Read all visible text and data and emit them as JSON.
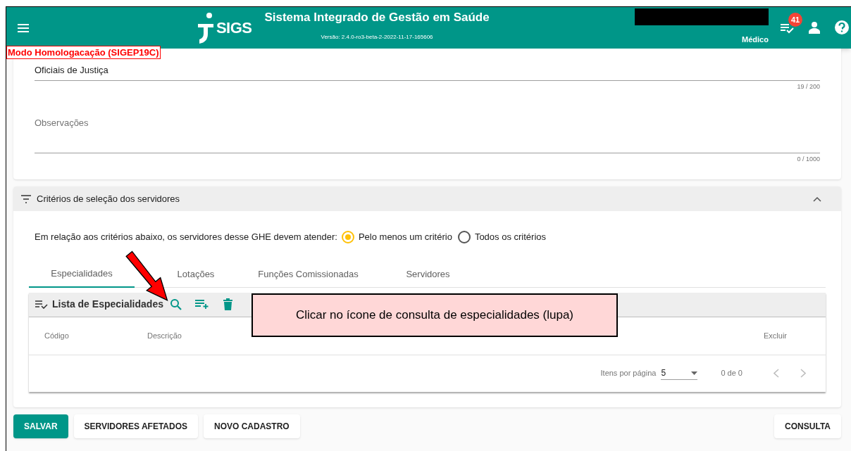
{
  "app_bar": {
    "title": "Sistema Integrado de Gestão em Saúde",
    "logo_text": "SIGS",
    "version": "Versão: 2.4.0-ro3-beta-2-2022-11-17-165606",
    "role": "Médico",
    "notification_count": "41"
  },
  "mode_badge": "Modo Homologacação (SIGEP19C)",
  "form": {
    "fields": [
      {
        "value": "Oficiais de Justiça",
        "counter": "19 / 200",
        "kind": "text"
      },
      {
        "placeholder": "Observações",
        "counter": "0 / 1000",
        "kind": "textarea"
      }
    ]
  },
  "criteria": {
    "title": "Critérios de seleção dos servidores",
    "expanded": true,
    "prompt": "Em relação aos critérios abaixo, os servidores desse GHE devem atender:",
    "options": [
      {
        "label": "Pelo menos um critério",
        "selected": true
      },
      {
        "label": "Todos os critérios",
        "selected": false
      }
    ],
    "tabs": [
      {
        "label": "Especialidades",
        "selected": true
      },
      {
        "label": "Lotações",
        "selected": false
      },
      {
        "label": "Funções Comissionadas",
        "selected": false
      },
      {
        "label": "Servidores",
        "selected": false
      }
    ],
    "list_title": "Lista de Especialidades",
    "columns": [
      "Código",
      "Descrição",
      "Excluir"
    ],
    "paginator": {
      "label": "Itens por página",
      "page_size": "5",
      "range": "0 de 0"
    }
  },
  "buttons": [
    {
      "label": "SALVAR",
      "kind": "primary"
    },
    {
      "label": "SERVIDORES AFETADOS",
      "kind": "plain"
    },
    {
      "label": "NOVO CADASTRO",
      "kind": "plain"
    },
    {
      "label": "CONSULTA",
      "kind": "plain"
    }
  ],
  "callout": "Clicar no ícone de consulta de especialidades (lupa)"
}
